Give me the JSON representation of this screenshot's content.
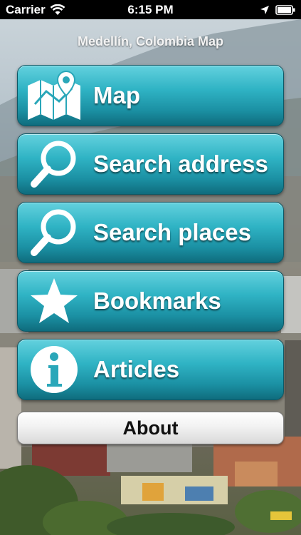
{
  "status_bar": {
    "carrier": "Carrier",
    "time": "6:15 PM"
  },
  "app": {
    "title": "Medellín, Colombia Map"
  },
  "menu": {
    "items": [
      {
        "label": "Map",
        "icon": "map-pin-icon"
      },
      {
        "label": "Search address",
        "icon": "magnifier-icon"
      },
      {
        "label": "Search places",
        "icon": "magnifier-icon"
      },
      {
        "label": "Bookmarks",
        "icon": "star-icon"
      },
      {
        "label": "Articles",
        "icon": "info-icon"
      }
    ],
    "about_label": "About"
  },
  "colors": {
    "button_top": "#63d1de",
    "button_bottom": "#0f6c7d",
    "status_bar": "#000000"
  }
}
